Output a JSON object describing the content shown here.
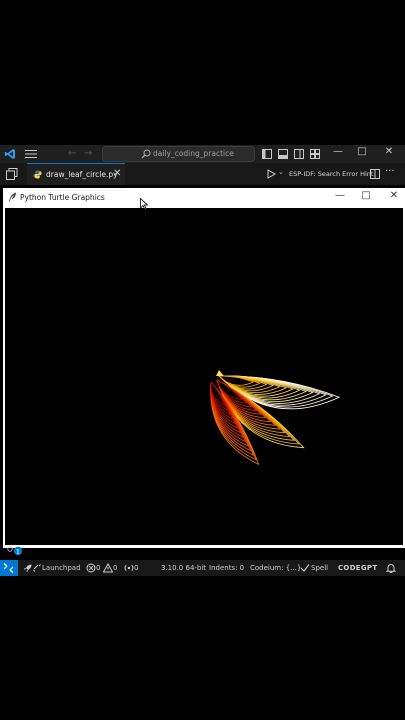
{
  "vscode": {
    "search_text": "daily_coding_practice",
    "nav_back": "←",
    "nav_forward": "→",
    "minimize": "—",
    "maximize": "□",
    "close": "✕"
  },
  "editor": {
    "tab_label": "draw_leaf_circle.py",
    "tab_close": "✕",
    "esp_label": "ESP-IDF: Search Error Hint",
    "more": "···"
  },
  "turtle_window": {
    "title": "Python Turtle Graphics",
    "minimize": "—",
    "maximize": "□",
    "close": "✕"
  },
  "status_bar": {
    "ports_count": "1",
    "launchpad": "Launchpad",
    "errors": "0",
    "warnings": "0",
    "ports": "0",
    "python_version": "3.10.0 64-bit",
    "indents": "Indents: 0",
    "codeium": "Codeium: {...}",
    "spell": "Spell",
    "codegpt": "CODEGPT"
  },
  "colors": {
    "accent": "#0078d4",
    "leaf_gradient": [
      "#ffffff",
      "#ffe07a",
      "#ffb000",
      "#ff6a00",
      "#e02a00",
      "#b00000"
    ]
  },
  "icons": [
    "vscode-logo-icon",
    "menu-icon",
    "search-icon",
    "layout-icon",
    "explorer-icon",
    "python-file-icon",
    "run-icon",
    "split-editor-icon",
    "feather-icon",
    "cursor-icon",
    "ports-icon",
    "remote-icon",
    "error-icon",
    "warning-icon",
    "broadcast-icon",
    "check-icon",
    "bell-icon"
  ]
}
